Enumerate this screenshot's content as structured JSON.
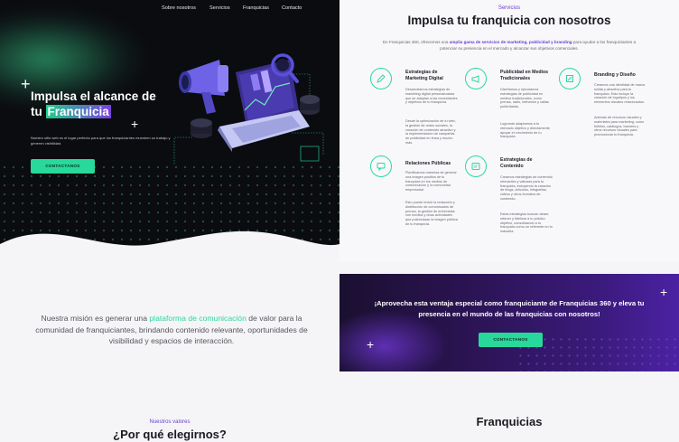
{
  "nav": {
    "items": [
      "Sobre nosotros",
      "Servicios",
      "Franquicias",
      "Contacto"
    ]
  },
  "hero": {
    "title_line1": "Impulsa el alcance de",
    "title_line2_plain": "tu ",
    "title_line2_highlight": "Franquicia",
    "subtitle": "Nuestro sitio web es el lugar perfecto para que los franquiciantes muestren su trabajo y generen visibilidad.",
    "button": "CONTACTANOS",
    "illustration": "megaphone-laptop-illustration"
  },
  "services": {
    "eyebrow": "Servicios",
    "title": "Impulsa tu franquicia con nosotros",
    "intro_a": "En Franquicias 360, ofrecemos una ",
    "intro_b": "amplia gama de servicios de marketing, publicidad y branding",
    "intro_c": " para ayudar a los franquiciantes a potenciar su presencia en el mercado y alcanzar sus objetivos comerciales.",
    "items": [
      {
        "name": "Estrategias de Marketing Digital",
        "icon": "pencil-icon",
        "text1": "Desarrollamos estrategias de marketing digital personalizadas que se adaptan a las necesidades y objetivos de tu franquicia.",
        "text2": "Desde la optimización de tu web, la gestión de redes sociales, la creación de contenido atractivo y la implementación de campañas de publicidad en línea y mucho más."
      },
      {
        "name": "Publicidad en Medios Tradicionales",
        "icon": "megaphone-icon",
        "text1": "Diseñamos y ejecutamos estrategias de publicidad en medios tradicionales, como prensa, radio, televisión y vallas publicitarias.",
        "text2": "Logrando adaptamos a tu mercado objetivo y directamente apoyar el crecimiento de tu franquicia."
      },
      {
        "name": "Branding y Diseño",
        "icon": "brush-icon",
        "text1": "Creamos una identidad de marca sólida y atractiva para tu franquicia. Esto incluye la creación de logotipos y los elementos visuales relacionados.",
        "text2": "Además de recursos visuales y materiales para marketing, como folletos, catálogos, banners y otros recursos visuales para promocionar tu franquicia."
      },
      {
        "name": "Relaciones Públicas",
        "icon": "chat-icon",
        "text1": "Planificamos maneras de generar una imagen positiva de tu franquicia en los medios de comunicación y la comunidad empresarial.",
        "text2": "Esto puede incluir la redacción y distribución de comunicados de prensa, la gestión de entrevistas con medios y otras actividades que potenciaran la imagen pública de tu franquicia."
      },
      {
        "name": "Estrategias de Contenido",
        "icon": "document-icon",
        "text1": "Creamos estrategias de contenido relevantes y valiosas para tu franquicia, incluyendo la creación de blogs, artículos, infografías, videos y otros formatos de contenido.",
        "text2": "Estas estrategias buscan atraer, retener y fidelizar a tu público objetivo, consolidando a tu franquicia como un referente en tu industria."
      }
    ]
  },
  "mission": {
    "text_a": "Nuestra misión es generar una ",
    "text_highlight": "plataforma de comunicación",
    "text_b": " de valor para la comunidad de franquiciantes, brindando contenido relevante, oportunidades de visibilidad y espacios de interacción."
  },
  "cta": {
    "text": "¡Aprovecha esta ventaja especial como franquiciante de Franquicias 360 y eleva tu presencia en el mundo de las franquicias con nosotros!",
    "button": "CONTACTANOS"
  },
  "values": {
    "eyebrow": "Nuestros valores",
    "title": "¿Por qué elegirnos?"
  },
  "franquicias": {
    "title": "Franquicias"
  },
  "colors": {
    "accent_green": "#27d99a",
    "accent_purple": "#6b3fd4",
    "dark_bg": "#0b0c10"
  }
}
